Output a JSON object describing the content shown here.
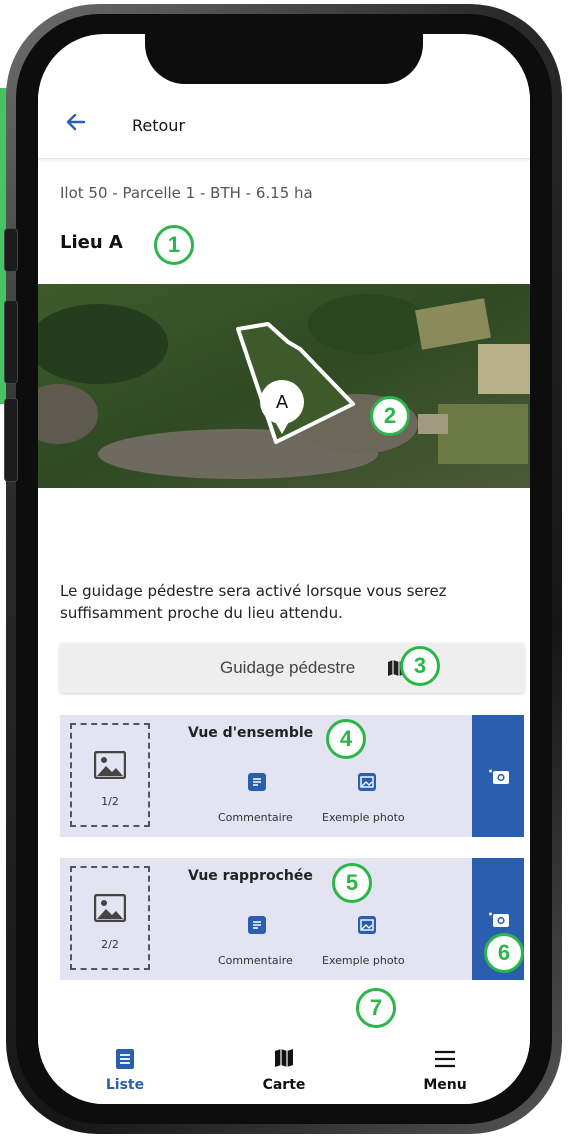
{
  "header": {
    "back_label": "Retour"
  },
  "place": {
    "subtitle": "Ilot 50 - Parcelle 1 - BTH - 6.15 ha",
    "title": "Lieu A",
    "map_marker": "A"
  },
  "guidance": {
    "text": "Le guidage pédestre sera activé lorsque vous serez suffisamment proche du lieu attendu.",
    "button_label": "Guidage pédestre",
    "button_icon": "map-icon"
  },
  "photos": [
    {
      "title": "Vue d'ensemble",
      "count": "1/2",
      "comment_label": "Commentaire",
      "example_label": "Exemple photo"
    },
    {
      "title": "Vue rapprochée",
      "count": "2/2",
      "comment_label": "Commentaire",
      "example_label": "Exemple photo"
    }
  ],
  "badges": [
    "1",
    "2",
    "3",
    "4",
    "5",
    "6",
    "7"
  ],
  "nav": {
    "items": [
      {
        "label": "Liste",
        "icon": "list-icon",
        "active": true
      },
      {
        "label": "Carte",
        "icon": "map-icon",
        "active": false
      },
      {
        "label": "Menu",
        "icon": "hamburger-icon",
        "active": false
      }
    ]
  },
  "colors": {
    "accent": "#2a5fb0",
    "badge": "#2bb64a",
    "card_bg": "#e3e3f2"
  }
}
